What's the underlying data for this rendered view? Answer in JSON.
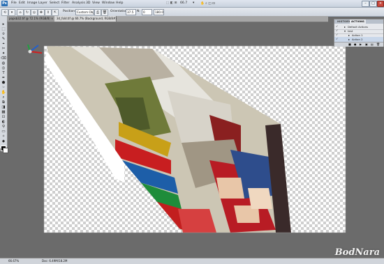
{
  "app": {
    "logo": "Ps"
  },
  "menu": [
    "File",
    "Edit",
    "Image",
    "Layer",
    "Select",
    "Filter",
    "Analysis",
    "3D",
    "View",
    "Window",
    "Help"
  ],
  "workspace": {
    "zoom": "66.7",
    "arrange": "▾"
  },
  "window_buttons": {
    "minimize": "–",
    "maximize": "□",
    "close": "×"
  },
  "options_bar": {
    "position_label": "Position:",
    "position_value": "Custom Objec...",
    "orientation_label": "Orientation:",
    "orientation_value": "37.5",
    "n_label": "N:",
    "n_value": "0",
    "value_3": "180.0"
  },
  "tabs": [
    {
      "label": "popsb32.tif @ 72.1% (RGB/8) ×"
    },
    {
      "label": "3d_fold.tif @ 66.7% (Background, RGB/8#)"
    }
  ],
  "tools": [
    "▸",
    "⬚",
    "⌾",
    "✎",
    "⌖",
    "✂",
    "✦",
    "⌫",
    "◍",
    "◎",
    "T",
    "✒",
    "⬟",
    "☞",
    "✋",
    "⌕",
    "⧉",
    "◨",
    "▦",
    "⊡",
    "◐",
    "⚲",
    "▭",
    "✧",
    "◆"
  ],
  "actions_panel": {
    "tabs": [
      "HISTORY",
      "ACTIONS"
    ],
    "rows": [
      {
        "check": "✓",
        "expander": "▸",
        "label": "Default Actions"
      },
      {
        "check": "✓",
        "expander": "▾",
        "label": "test"
      },
      {
        "check": "✓",
        "expander": "▸",
        "label": "Action 1"
      },
      {
        "check": "✓",
        "expander": "▸",
        "label": "Action 2"
      }
    ],
    "footer_icons": [
      "■",
      "●",
      "▶",
      "▣",
      "▤",
      "🗑"
    ]
  },
  "status_bar": {
    "zoom": "66.67%",
    "doc": "Doc: 6.49M/18.2M"
  },
  "watermark": "BodNara",
  "colors": {
    "accent": "#2a6fb5",
    "canvas_bg": "#6b6b6b"
  }
}
